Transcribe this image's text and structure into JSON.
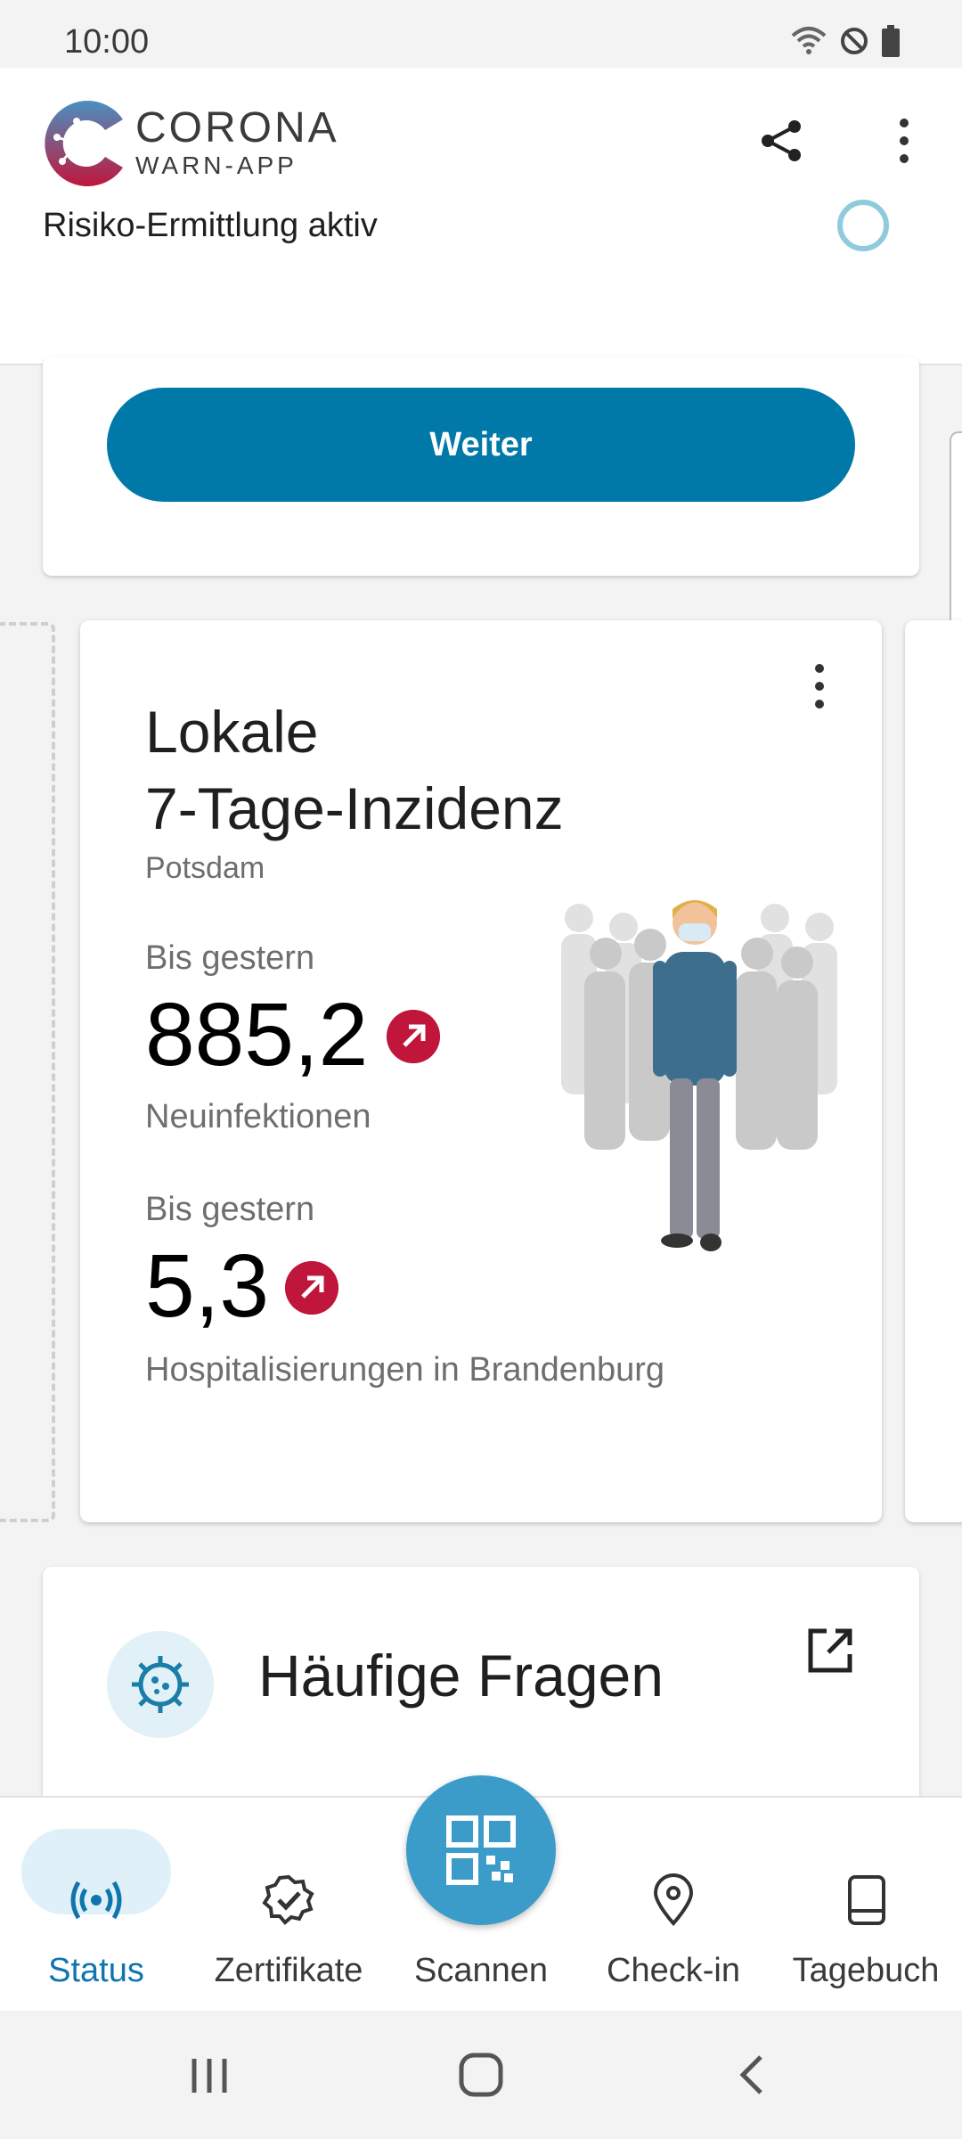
{
  "status_bar": {
    "time": "10:00"
  },
  "header": {
    "logo_title": "CORONA",
    "logo_subtitle": "WARN-APP",
    "risk_label": "Risiko-Ermittlung aktiv"
  },
  "risk_card": {
    "button_label": "Weiter"
  },
  "incidence_card": {
    "title": "Lokale\n7-Tage-Inzidenz",
    "location": "Potsdam",
    "infections": {
      "label": "Bis gestern",
      "value": "885,2",
      "description": "Neuinfektionen",
      "trend": "up"
    },
    "hospitalizations": {
      "label": "Bis gestern",
      "value": "5,3",
      "description": "Hospitalisierungen in Brandenburg",
      "trend": "up"
    }
  },
  "faq_card": {
    "title": "Häufige Fragen"
  },
  "bottom_nav": {
    "items": [
      {
        "label": "Status",
        "icon": "status-icon",
        "active": true
      },
      {
        "label": "Zertifikate",
        "icon": "certificate-icon"
      },
      {
        "label": "Scannen",
        "icon": "qr-code-icon"
      },
      {
        "label": "Check-in",
        "icon": "location-pin-icon"
      },
      {
        "label": "Tagebuch",
        "icon": "diary-icon"
      }
    ]
  },
  "colors": {
    "primary": "#0078a8",
    "fab": "#3b9cc9",
    "trend_red": "#c0163b",
    "active_nav": "#0f75ad"
  }
}
